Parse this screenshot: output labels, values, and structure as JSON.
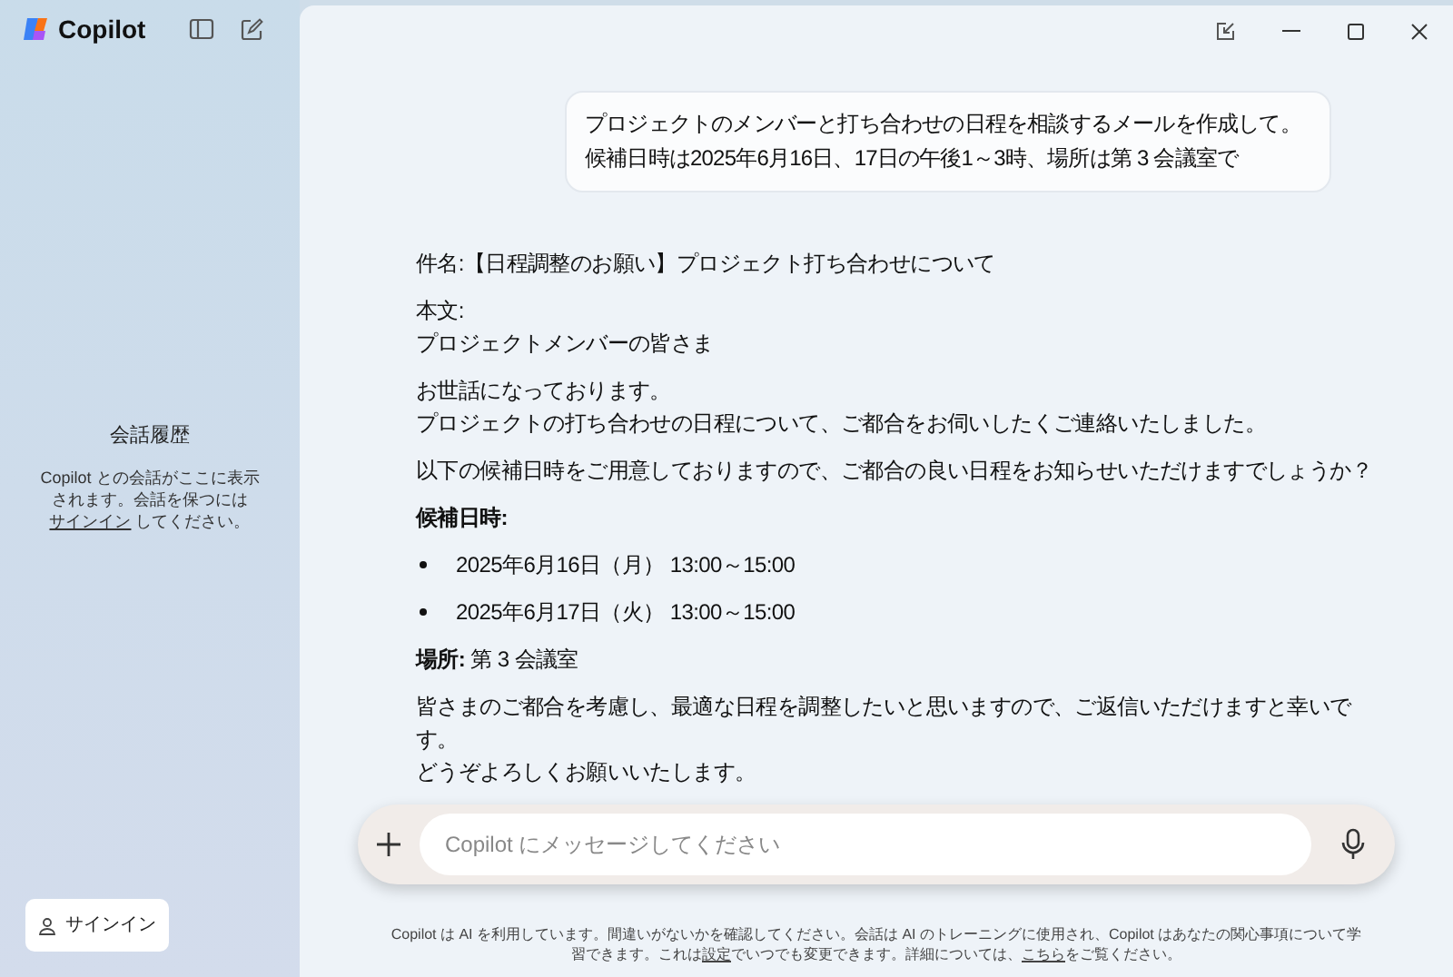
{
  "app": {
    "name": "Copilot"
  },
  "sidebar": {
    "history_title": "会話履歴",
    "history_note": [
      {
        "text": "Copilot との会話がここに表示されます。会話を保つには "
      },
      {
        "text": "サインイン",
        "kind": "link"
      },
      {
        "text": " してください。"
      }
    ],
    "signin_button": "サインイン"
  },
  "user_message": "プロジェクトのメンバーと打ち合わせの日程を相談するメールを作成して。候補日時は2025年6月16日、17日の午後1～3時、場所は第 3 会議室で",
  "response": [
    {
      "kind": "paragraph",
      "lines": [
        "件名:【日程調整のお願い】プロジェクト打ち合わせについて"
      ]
    },
    {
      "kind": "paragraph",
      "lines": [
        "本文:",
        "プロジェクトメンバーの皆さま"
      ]
    },
    {
      "kind": "paragraph",
      "lines": [
        "お世話になっております。",
        "プロジェクトの打ち合わせの日程について、ご都合をお伺いしたくご連絡いたしました。"
      ]
    },
    {
      "kind": "paragraph",
      "lines": [
        "以下の候補日時をご用意しておりますので、ご都合の良い日程をお知らせいただけますでしょうか？"
      ]
    },
    {
      "kind": "heading",
      "lines": [
        "候補日時:"
      ]
    },
    {
      "kind": "bullet",
      "lines": [
        "2025年6月16日（月） 13:00～15:00"
      ]
    },
    {
      "kind": "bullet",
      "lines": [
        "2025年6月17日（火） 13:00～15:00"
      ]
    },
    {
      "kind": "paragraph",
      "lines": [
        "**場所:** 第 3 会議室"
      ]
    },
    {
      "kind": "paragraph",
      "lines": [
        "皆さまのご都合を考慮し、最適な日程を調整したいと思いますので、ご返信いただけますと幸いです。",
        "どうぞよろしくお願いいたします。"
      ]
    }
  ],
  "composer": {
    "placeholder": "Copilot にメッセージしてください"
  },
  "disclaimer": [
    {
      "text": "Copilot は AI を利用しています。間違いがないかを確認してください。会話は AI のトレーニングに使用され、Copilot はあなたの関心事項について学習できます。これは"
    },
    {
      "text": "設定",
      "kind": "link"
    },
    {
      "text": "でいつでも変更できます。詳細については、"
    },
    {
      "text": "こちら",
      "kind": "link"
    },
    {
      "text": "をご覧ください。"
    }
  ]
}
